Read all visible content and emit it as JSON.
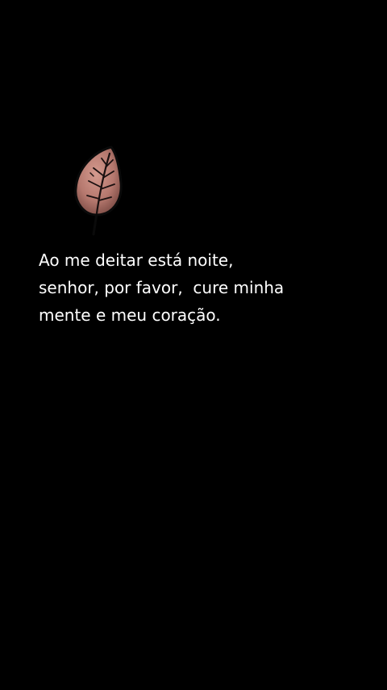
{
  "icon": "leaf-icon",
  "colors": {
    "background": "#000000",
    "text": "#ffffff",
    "leaf_fill": "#b5786e",
    "leaf_outline": "#0a0a0a"
  },
  "quote": {
    "lines": [
      "Ao me deitar está noite,",
      "senhor, por favor,  cure minha",
      "mente e meu coração."
    ]
  }
}
